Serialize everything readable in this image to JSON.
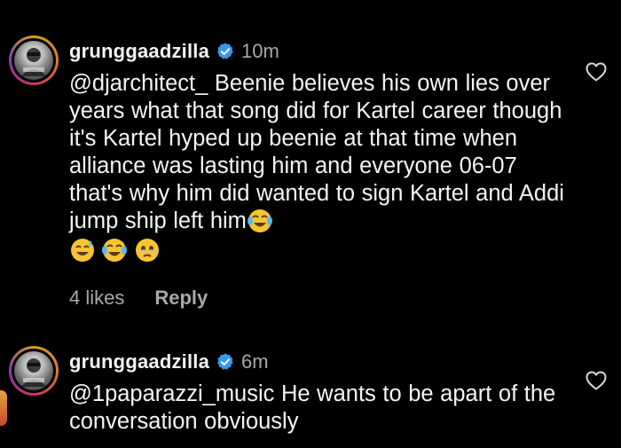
{
  "comments": [
    {
      "username": "grunggaadzilla",
      "time": "10m",
      "mention": "@djarchitect_",
      "text": "Beenie believes his own lies over years what that song did for Kartel career though it's Kartel hyped up beenie at that time when alliance was lasting him and everyone 06-07 that's why him did wanted to sign Kartel and Addi jump ship left him",
      "emojis": [
        "face-with-tears-of-joy",
        "grinning-face-with-sweat",
        "face-with-tears-of-joy",
        "face-holding-back-tears"
      ],
      "likes": "4 likes",
      "reply": "Reply"
    },
    {
      "username": "grunggaadzilla",
      "time": "6m",
      "mention": "@1paparazzi_music",
      "text": "He wants to be apart of the conversation obviously"
    }
  ],
  "colors": {
    "background": "#000000",
    "text": "#f5f5f5",
    "muted": "#a8a8a8",
    "verified": "#3897f0"
  }
}
